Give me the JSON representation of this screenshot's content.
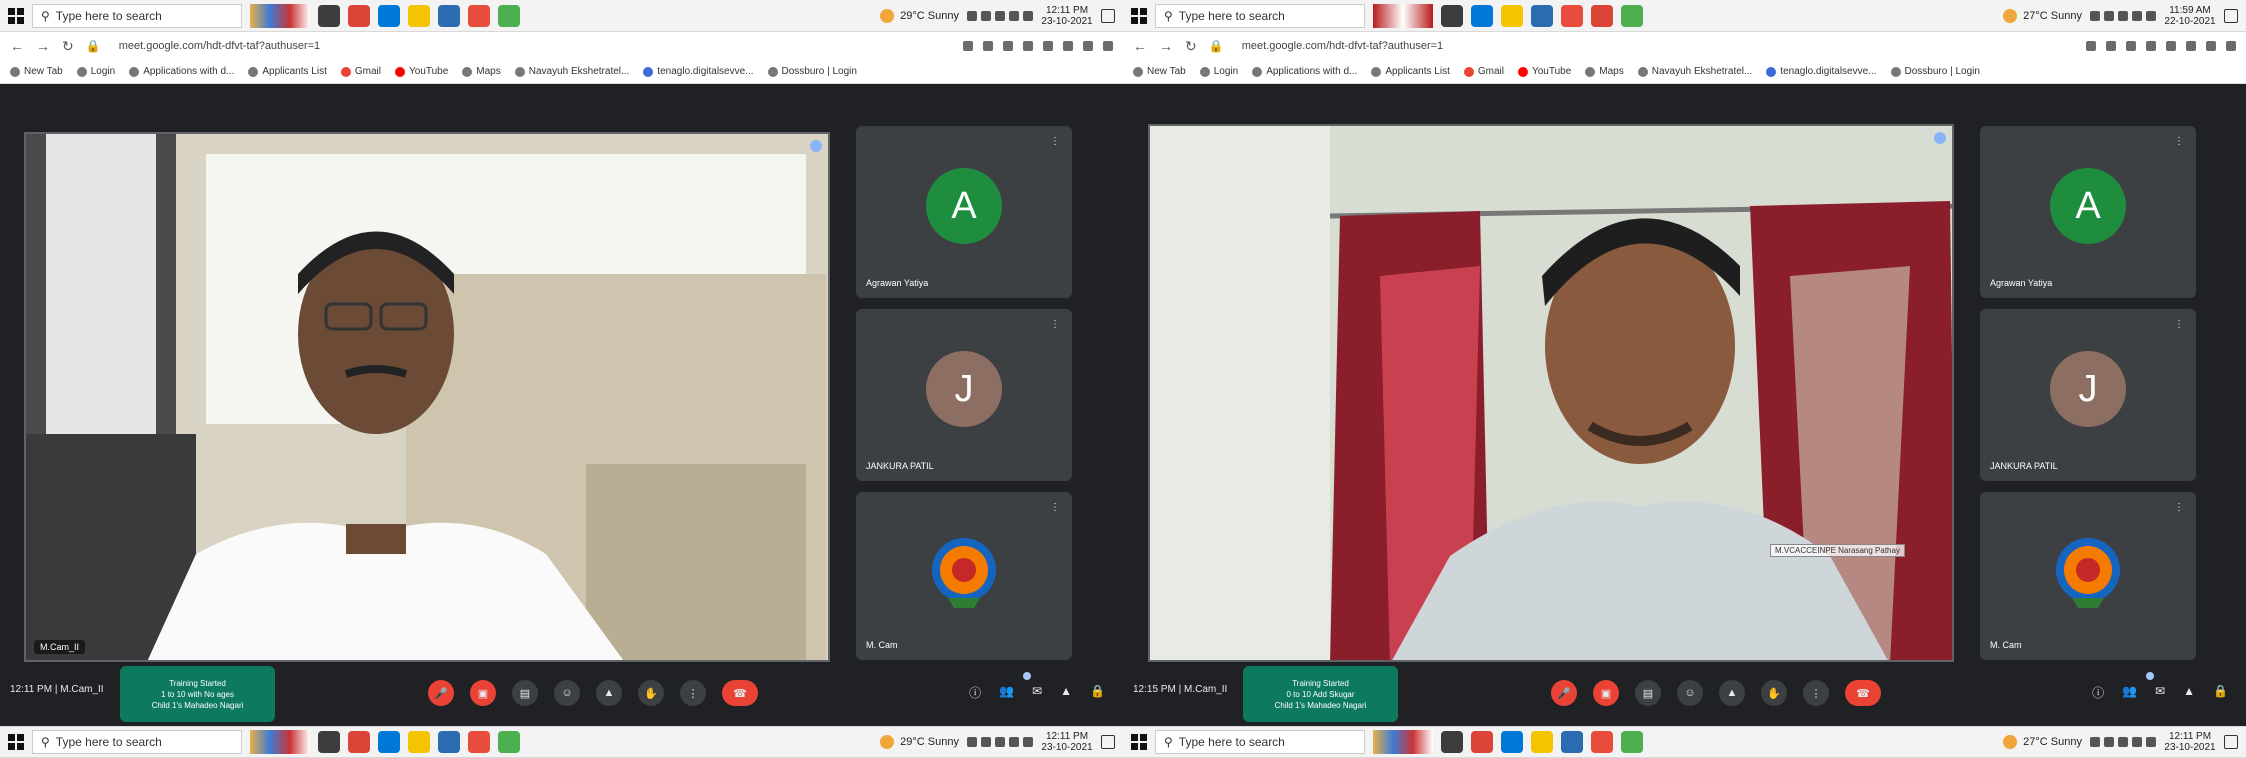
{
  "left": {
    "taskbar_top": {
      "search_placeholder": "Type here to search",
      "weather": "29°C Sunny",
      "time": "12:11 PM",
      "date": "23-10-2021"
    },
    "address": {
      "url": "meet.google.com/hdt-dfvt-taf?authuser=1"
    },
    "bookmarks": [
      "New Tab",
      "Login",
      "Applications with d...",
      "Applicants List",
      "Gmail",
      "YouTube",
      "Maps",
      "Navayuh Ekshetratel...",
      "tenaglo.digitalsevve...",
      "Dossburo | Login"
    ],
    "main_tile": {
      "name": "M.Cam_II"
    },
    "side_tiles": [
      {
        "initial": "A",
        "name": "Agrawan Yatiya",
        "color": "#1e8e3e"
      },
      {
        "initial": "J",
        "name": "JANKURA PATIL",
        "color": "#8d6e63"
      },
      {
        "initial": "",
        "name": "M. Cam",
        "color": ""
      }
    ],
    "meeting": {
      "time": "12:11 PM",
      "code": "M.Cam_II"
    },
    "chat_popup": [
      "Training Started",
      "1 to 10 with No ages",
      "Child 1's Mahadeo Nagari"
    ],
    "taskbar_bottom": {
      "search_placeholder": "Type here to search",
      "weather": "29°C Sunny",
      "time": "12:11 PM",
      "date": "23-10-2021"
    }
  },
  "right": {
    "taskbar_top": {
      "search_placeholder": "Type here to search",
      "weather": "27°C Sunny",
      "time": "11:59 AM",
      "date": "22-10-2021"
    },
    "address": {
      "url": "meet.google.com/hdt-dfvt-taf?authuser=1"
    },
    "bookmarks": [
      "New Tab",
      "Login",
      "Applications with d...",
      "Applicants List",
      "Gmail",
      "YouTube",
      "Maps",
      "Navayuh Ekshetratel...",
      "tenaglo.digitalsevve...",
      "Dossburo | Login"
    ],
    "main_tile": {
      "name": "",
      "caption": "M.VCACCEINPE Narasang Pathay"
    },
    "side_tiles": [
      {
        "initial": "A",
        "name": "Agrawan Yatiya",
        "color": "#1e8e3e"
      },
      {
        "initial": "J",
        "name": "JANKURA PATIL",
        "color": "#8d6e63"
      },
      {
        "initial": "",
        "name": "M. Cam",
        "color": ""
      }
    ],
    "meeting": {
      "time": "12:15 PM",
      "code": "M.Cam_II"
    },
    "chat_popup": [
      "Training Started",
      "0 to 10 Add Skugar",
      "Child 1's Mahadeo Nagari"
    ],
    "taskbar_bottom": {
      "search_placeholder": "Type here to search",
      "weather": "27°C Sunny",
      "time": "12:11 PM",
      "date": "23-10-2021"
    }
  }
}
